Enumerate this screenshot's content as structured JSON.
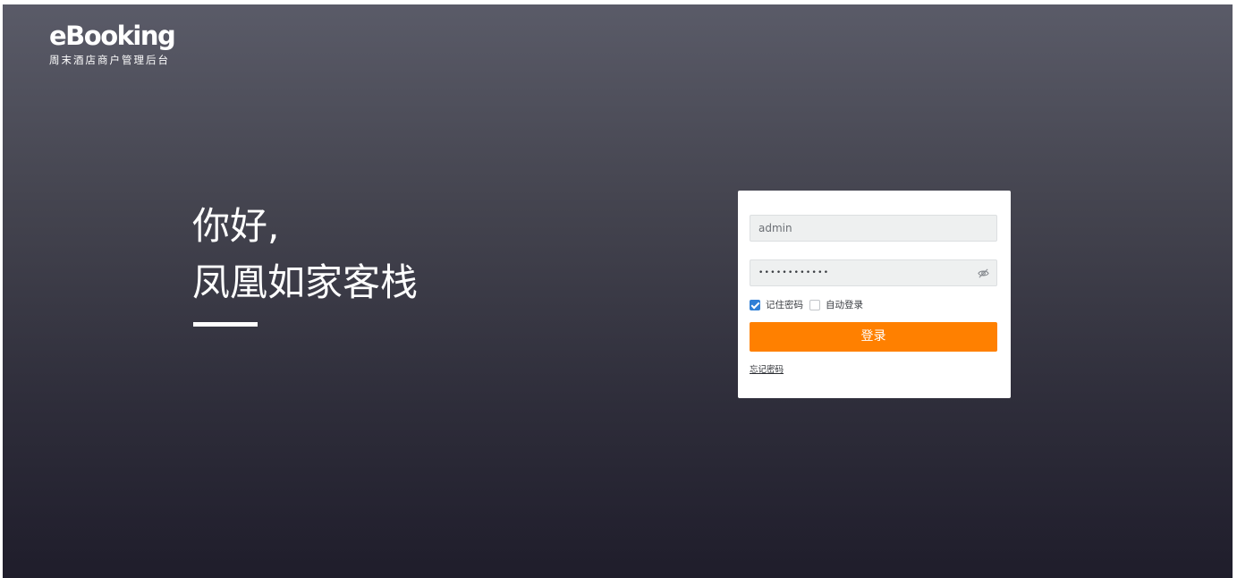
{
  "brand": {
    "logo_text": "eBooking",
    "subtitle": "周末酒店商户管理后台"
  },
  "greeting": {
    "line1": "你好,",
    "line2": "凤凰如家客栈"
  },
  "login": {
    "username_value": "admin",
    "password_value": "••••••••••••",
    "remember_password": {
      "label": "记住密码",
      "checked": true
    },
    "auto_login": {
      "label": "自动登录",
      "checked": false
    },
    "submit_label": "登录",
    "forgot_label": "忘记密码"
  },
  "icons": {
    "password_toggle": "eye-slash-icon"
  },
  "colors": {
    "accent": "#ff8000",
    "checkbox_checked": "#2f7fd6",
    "background_top": "#5a5b68",
    "background_bottom": "#1f1d2b"
  }
}
